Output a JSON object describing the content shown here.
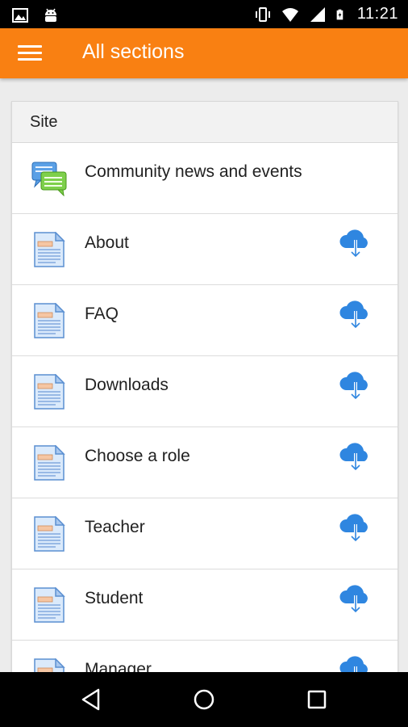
{
  "status_bar": {
    "time": "11:21",
    "icons": [
      "image-icon",
      "android-icon",
      "vibrate-icon",
      "wifi-icon",
      "signal-icon",
      "battery-charging-icon"
    ]
  },
  "app_bar": {
    "title": "All sections",
    "menu_icon": "hamburger-menu-icon"
  },
  "card": {
    "header": "Site",
    "items": [
      {
        "label": "Community news and events",
        "icon": "forum-icon",
        "downloadable": false
      },
      {
        "label": "About",
        "icon": "page-icon",
        "downloadable": true
      },
      {
        "label": "FAQ",
        "icon": "page-icon",
        "downloadable": true
      },
      {
        "label": "Downloads",
        "icon": "page-icon",
        "downloadable": true
      },
      {
        "label": "Choose a role",
        "icon": "page-icon",
        "downloadable": true
      },
      {
        "label": "Teacher",
        "icon": "page-icon",
        "downloadable": true
      },
      {
        "label": "Student",
        "icon": "page-icon",
        "downloadable": true
      },
      {
        "label": "Manager",
        "icon": "page-icon",
        "downloadable": true
      }
    ]
  },
  "nav_bar": {
    "icons": [
      "back-icon",
      "home-icon",
      "recents-icon"
    ]
  },
  "colors": {
    "accent": "#f98012",
    "download_blue": "#2f86e0"
  }
}
